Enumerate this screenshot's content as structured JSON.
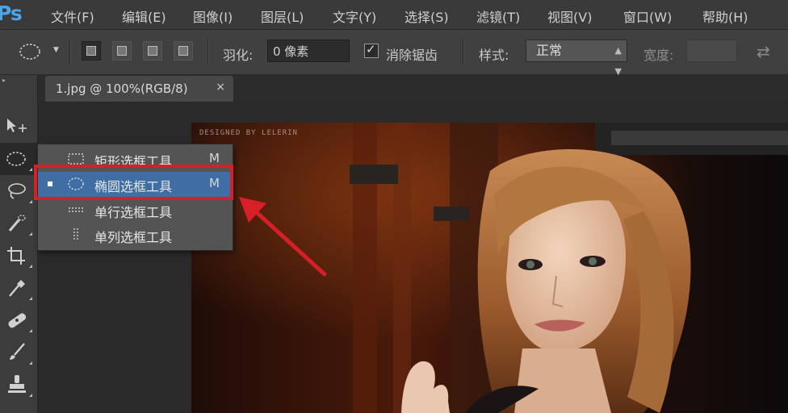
{
  "menubar": {
    "logo": "Ps",
    "items": [
      {
        "label": "文件(F)"
      },
      {
        "label": "编辑(E)"
      },
      {
        "label": "图像(I)"
      },
      {
        "label": "图层(L)"
      },
      {
        "label": "文字(Y)"
      },
      {
        "label": "选择(S)"
      },
      {
        "label": "滤镜(T)"
      },
      {
        "label": "视图(V)"
      },
      {
        "label": "窗口(W)"
      },
      {
        "label": "帮助(H)"
      }
    ]
  },
  "options": {
    "feather_label": "羽化:",
    "feather_value": "0 像素",
    "antialias_label": "消除锯齿",
    "antialias_checked": true,
    "style_label": "样式:",
    "style_value": "正常",
    "width_label": "宽度:"
  },
  "document": {
    "tab_title": "1.jpg @ 100%(RGB/8)",
    "close_glyph": "×",
    "watermark": "DESIGNED BY LELERIN"
  },
  "flyout": {
    "items": [
      {
        "label": "矩形选框工具",
        "shortcut": "M",
        "icon": "rect-marquee-icon",
        "selected": false
      },
      {
        "label": "椭圆选框工具",
        "shortcut": "M",
        "icon": "ellipse-marquee-icon",
        "selected": true
      },
      {
        "label": "单行选框工具",
        "shortcut": "",
        "icon": "single-row-marquee-icon",
        "selected": false
      },
      {
        "label": "单列选框工具",
        "shortcut": "",
        "icon": "single-column-marquee-icon",
        "selected": false
      }
    ]
  },
  "toolbar": {
    "tools": [
      "move-tool-icon",
      "ellipse-marquee-tool-icon",
      "lasso-tool-icon",
      "quick-selection-tool-icon",
      "crop-tool-icon",
      "eyedropper-tool-icon",
      "healing-brush-tool-icon",
      "brush-tool-icon",
      "clone-stamp-tool-icon"
    ]
  },
  "colors": {
    "accent_highlight": "#d61f26",
    "selection_blue": "#3f6ea5",
    "logo_blue": "#4aa6e8",
    "ui_bg": "#3a3a3a"
  }
}
